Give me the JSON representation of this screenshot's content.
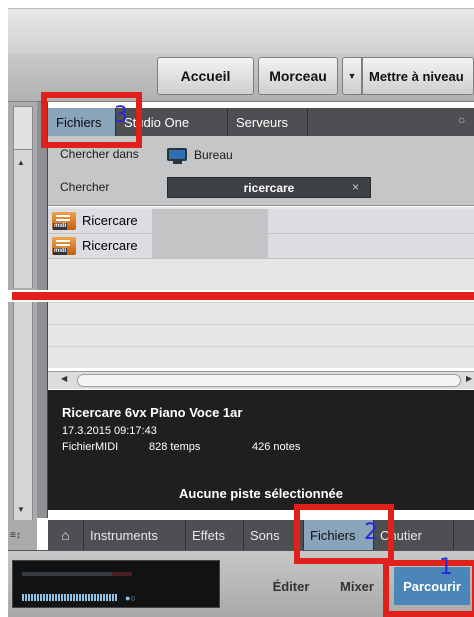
{
  "toolbar": {
    "home_label": "Accueil",
    "song_label": "Morceau",
    "caret": "▼",
    "update_label": "Mettre à niveau"
  },
  "browser": {
    "tabs": [
      {
        "label": "Fichiers",
        "active": true
      },
      {
        "label": "Studio One",
        "active": false
      },
      {
        "label": "Serveurs",
        "active": false
      }
    ],
    "look_in_label": "Chercher dans",
    "look_in_value": "Bureau",
    "search_label": "Chercher",
    "search_value": "ricercare",
    "clear_icon": "×",
    "results": [
      {
        "name": "Ricercare",
        "icon": "midi-file-icon"
      },
      {
        "name": "Ricercare",
        "icon": "midi-file-icon"
      }
    ]
  },
  "info": {
    "title": "Ricercare 6vx Piano Voce 1ar",
    "date": "17.3.2015 09:17:43",
    "type": "FichierMIDI",
    "beats": "828 temps",
    "notes": "426 notes",
    "status": "Aucune piste sélectionnée"
  },
  "bottom_tabs": [
    {
      "label": "Instruments",
      "active": false
    },
    {
      "label": "Effets",
      "active": false
    },
    {
      "label": "Sons",
      "active": false
    },
    {
      "label": "Fichiers",
      "active": true
    },
    {
      "label": "Chutier",
      "active": false
    }
  ],
  "bottom_bar": {
    "edit_label": "Éditer",
    "mixer_label": "Mixer",
    "browse_label": "Parcourir"
  },
  "annotations": {
    "n1": "1",
    "n2": "2",
    "n3": "3"
  },
  "colors": {
    "highlight_red": "#e0211b",
    "active_tab_blue": "#8aa4bc",
    "browse_blue": "#4c86b8",
    "number_blue": "#2b2bd6"
  }
}
